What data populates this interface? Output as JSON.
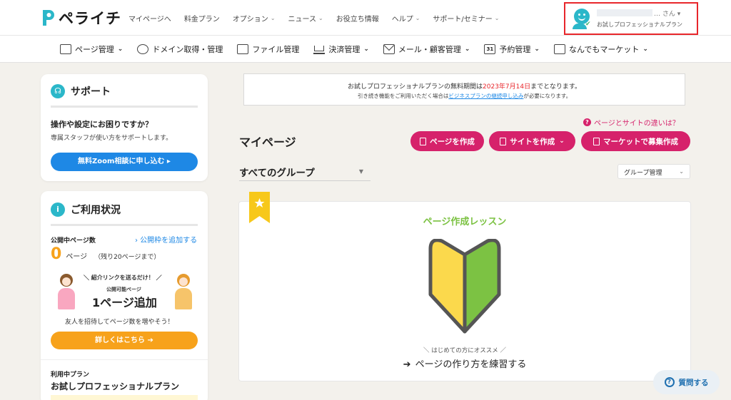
{
  "colors": {
    "accent_pink": "#d6226b",
    "accent_blue": "#1e88e5",
    "accent_orange": "#f7a21b",
    "accent_green": "#7cc243",
    "highlight_red": "#e8262b",
    "background": "#f3f1ec"
  },
  "header": {
    "logo_text": "ペライチ",
    "nav": [
      {
        "label": "マイページへ",
        "dropdown": false
      },
      {
        "label": "料金プラン",
        "dropdown": false
      },
      {
        "label": "オプション",
        "dropdown": true
      },
      {
        "label": "ニュース",
        "dropdown": true
      },
      {
        "label": "お役立ち情報",
        "dropdown": false
      },
      {
        "label": "ヘルプ",
        "dropdown": true
      },
      {
        "label": "サポート/セミナー",
        "dropdown": true
      }
    ],
    "user": {
      "suffix": "… さん",
      "plan": "お試しプロフェッショナルプラン"
    }
  },
  "subnav": {
    "items": [
      {
        "label": "ページ管理",
        "icon": "page-manage-icon",
        "dropdown": true
      },
      {
        "label": "ドメイン取得・管理",
        "icon": "globe-icon",
        "dropdown": false
      },
      {
        "label": "ファイル管理",
        "icon": "file-icon",
        "dropdown": false
      },
      {
        "label": "決済管理",
        "icon": "cart-icon",
        "dropdown": true
      },
      {
        "label": "メール・顧客管理",
        "icon": "mail-icon",
        "dropdown": true
      },
      {
        "label": "予約管理",
        "icon": "calendar-icon",
        "calendar_num": "31",
        "dropdown": true
      },
      {
        "label": "なんでもマーケット",
        "icon": "store-icon",
        "dropdown": true
      }
    ]
  },
  "support": {
    "title": "サポート",
    "question": "操作や設定にお困りですか？",
    "description": "専属スタッフが使い方をサポートします。",
    "button": "無料Zoom相談に申し込む ▸"
  },
  "usage": {
    "title": "ご利用状況",
    "published_label": "公開中ページ数",
    "add_link": "› 公開枠を追加する",
    "count": "0",
    "count_unit": "ページ",
    "remaining": "（残り20ページまで）",
    "promo_top": "＼ 紹介リンクを送るだけ！ ／",
    "promo_mid": "公開可能ページ",
    "promo_big": "1ページ追加",
    "invite_text": "友人を招待してページ数を増やそう！",
    "details_button": "詳しくはこちら ➔",
    "plan_caption": "利用中プラン",
    "plan_name": "お試しプロフェッショナルプラン"
  },
  "notice": {
    "line1_prefix": "お試しプロフェッショナルプランの無料期間は",
    "line1_date": "2023年7月14日",
    "line1_suffix": "までとなります。",
    "line2_prefix": "引き続き機能をご利用いただく場合は",
    "line2_link": "ビジネスプランの継続申し込み",
    "line2_suffix": "が必要になります。"
  },
  "main": {
    "diff_link": "ページとサイトの違いは？",
    "title": "マイページ",
    "create_page": "ページを作成",
    "create_site": "サイトを作成",
    "market_recruit": "マーケットで募集作成",
    "group_select": "すべてのグループ",
    "group_manage": "グループ管理"
  },
  "lesson": {
    "title": "ページ作成レッスン",
    "recommend": "＼ はじめての方にオススメ ／",
    "practice": "ページの作り方を練習する"
  },
  "help": {
    "label": "質問する"
  }
}
